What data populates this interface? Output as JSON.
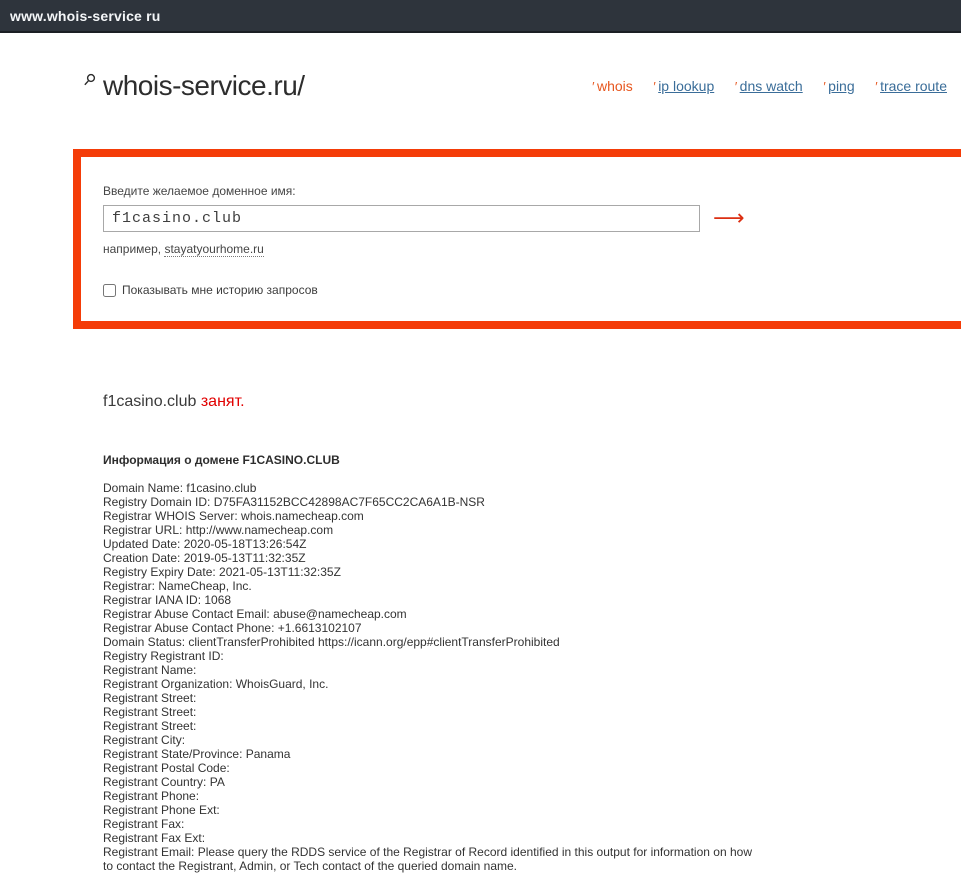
{
  "browser_bar": {
    "url_text": "www.whois-service ru"
  },
  "header": {
    "title": "whois-service.ru/"
  },
  "icons": {
    "search": "magnifier-glyph",
    "submit_arrow": "⟶",
    "nav_tick": "′"
  },
  "nav": {
    "items": [
      {
        "label": "whois",
        "active": true
      },
      {
        "label": "ip lookup",
        "active": false
      },
      {
        "label": "dns watch",
        "active": false
      },
      {
        "label": "ping",
        "active": false
      },
      {
        "label": "trace route",
        "active": false
      }
    ]
  },
  "search_panel": {
    "label": "Введите желаемое доменное имя:",
    "input_value": "f1casino.club",
    "hint_prefix": "например, ",
    "hint_link": "stayatyourhome.ru",
    "history_checkbox_label": "Показывать мне историю запросов",
    "history_checkbox_checked": false
  },
  "result": {
    "domain": "f1casino.club",
    "status": "занят.",
    "info_heading": "Информация о домене F1CASINO.CLUB",
    "whois_lines": [
      "Domain Name: f1casino.club",
      "Registry Domain ID: D75FA31152BCC42898AC7F65CC2CA6A1B-NSR",
      "Registrar WHOIS Server: whois.namecheap.com",
      "Registrar URL: http://www.namecheap.com",
      "Updated Date: 2020-05-18T13:26:54Z",
      "Creation Date: 2019-05-13T11:32:35Z",
      "Registry Expiry Date: 2021-05-13T11:32:35Z",
      "Registrar: NameCheap, Inc.",
      "Registrar IANA ID: 1068",
      "Registrar Abuse Contact Email: abuse@namecheap.com",
      "Registrar Abuse Contact Phone: +1.6613102107",
      "Domain Status: clientTransferProhibited https://icann.org/epp#clientTransferProhibited",
      "Registry Registrant ID:",
      "Registrant Name:",
      "Registrant Organization: WhoisGuard, Inc.",
      "Registrant Street:",
      "Registrant Street:",
      "Registrant Street:",
      "Registrant City:",
      "Registrant State/Province: Panama",
      "Registrant Postal Code:",
      "Registrant Country: PA",
      "Registrant Phone:",
      "Registrant Phone Ext:",
      "Registrant Fax:",
      "Registrant Fax Ext:",
      "Registrant Email: Please query the RDDS service of the Registrar of Record identified in this output for information on how",
      "to contact the Registrant, Admin, or Tech contact of the queried domain name."
    ]
  },
  "colors": {
    "accent_orange": "#f43c08",
    "topbar_bg": "#2e343c",
    "link_blue": "#3a6d99",
    "nav_active_orange": "#e7571f",
    "status_red": "#e10000",
    "arrow_red": "#dc2f12"
  }
}
